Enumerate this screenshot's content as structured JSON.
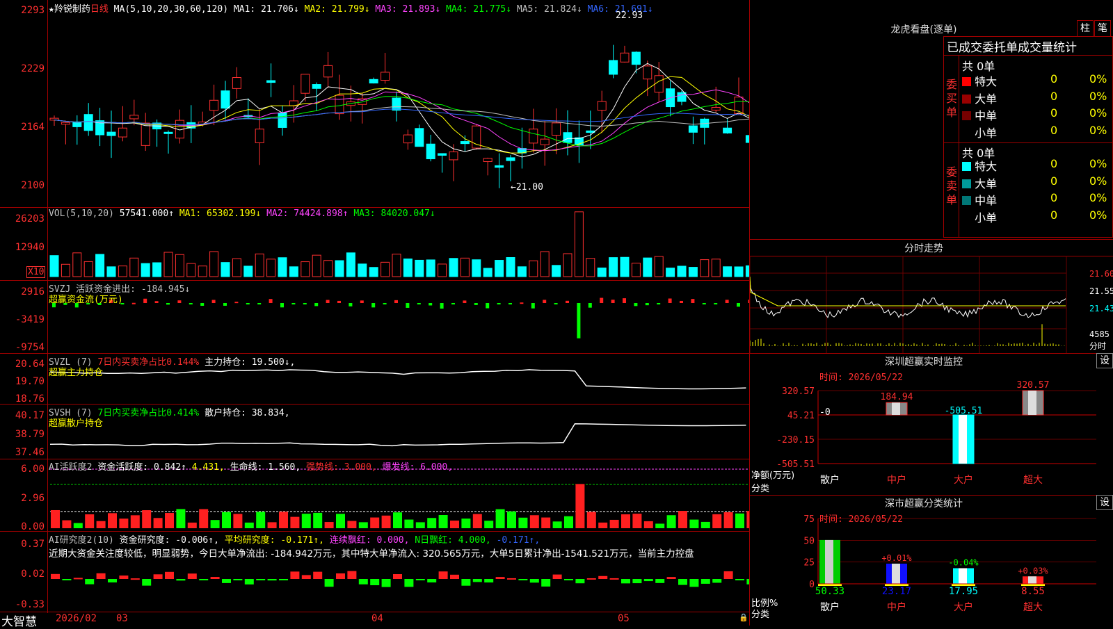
{
  "main_chart": {
    "stock_name": "★羚锐制药",
    "period": "日线",
    "ma_params": "MA(5,10,20,30,60,120)",
    "ma_items": [
      {
        "label": "MA1: 21.706↓",
        "color": "#ffffff"
      },
      {
        "label": "MA2: 21.799↓",
        "color": "#ffff00"
      },
      {
        "label": "MA3: 21.893↓",
        "color": "#ff44ff"
      },
      {
        "label": "MA4: 21.775↓",
        "color": "#00ff00"
      },
      {
        "label": "MA5: 21.824↓",
        "color": "#c0c0c0"
      },
      {
        "label": "MA6: 21.691↓",
        "color": "#3366ff"
      }
    ],
    "y_ticks": [
      "2293",
      "2229",
      "2164",
      "2100"
    ],
    "high_label": "22.93",
    "low_label": "←21.00"
  },
  "vol": {
    "legend": "VOL(5,10,20)",
    "value": "57541.000↑",
    "ma1": "MA1: 65302.199↓",
    "ma2": "MA2: 74424.898↑",
    "ma3": "MA3: 84020.047↓",
    "y_ticks": [
      "26203",
      "12940"
    ],
    "unit": "X10"
  },
  "svzj": {
    "legend": "SVZJ  活跃资金进出: -184.945↓",
    "sub": "超赢资金流(万元)",
    "y_ticks": [
      "2916",
      "-3419",
      "-9754"
    ]
  },
  "svzl": {
    "legend_a": "SVZL (7)",
    "legend_b": "7日内买卖净占比0.144%",
    "legend_c": "主力持仓: 19.500↓,",
    "sub": "超赢主力持仓",
    "y_ticks": [
      "20.64",
      "19.70",
      "18.76"
    ]
  },
  "svsh": {
    "legend_a": "SVSH (7)",
    "legend_b": "7日内买卖净占比0.414%",
    "legend_c": "散户持仓: 38.834,",
    "sub": "超赢散户持仓",
    "y_ticks": [
      "40.17",
      "38.79",
      "37.46"
    ]
  },
  "ai_active": {
    "legend_a": "AI活跃度2",
    "legend_b": "资金活跃度: 0.842↑",
    "legend_c": "4.431,",
    "legend_d": "生命线: 1.560,",
    "legend_e": "强势线: 3.000,",
    "legend_f": "爆发线: 6.000,",
    "y_ticks": [
      "6.00",
      "2.96",
      "0.00"
    ]
  },
  "ai_research": {
    "legend_a": "AI研究度2(10)",
    "legend_b": "资金研究度: -0.006↑,",
    "legend_c": "平均研究度: -0.171↑,",
    "legend_d": "连续飘红: 0.000,",
    "legend_e": "N日飘红: 4.000,",
    "legend_f": "-0.171↑,",
    "comment": "近期大资金关注度较低，明显弱势，今日大单净流出: -184.942万元，其中特大单净流入: 320.565万元，大单5日累计净出-1541.521万元，当前主力控盘",
    "y_ticks": [
      "0.37",
      "0.02",
      "-0.33"
    ]
  },
  "bottom_bar": {
    "brand": "大智慧",
    "dates": [
      "2026/02",
      "03",
      "04",
      "05"
    ]
  },
  "right_panel": {
    "dragon_title": "龙虎看盘(逐单)",
    "tab1": "柱",
    "tab2": "笔",
    "header": "已成交委托单成交量统计",
    "buy_label": "委买单",
    "sell_label": "委卖单",
    "buy_total": "共 0单",
    "sell_total": "共 0单",
    "buy_rows": [
      {
        "name": "特大",
        "count": "0",
        "pct": "0%",
        "color": "#ff0000"
      },
      {
        "name": "大单",
        "count": "0",
        "pct": "0%",
        "color": "#990000"
      },
      {
        "name": "中单",
        "count": "0",
        "pct": "0%",
        "color": "#770000"
      },
      {
        "name": "小单",
        "count": "0",
        "pct": "0%",
        "color": "#000000"
      }
    ],
    "sell_rows": [
      {
        "name": "特大",
        "count": "0",
        "pct": "0%",
        "color": "#00ffff"
      },
      {
        "name": "大单",
        "count": "0",
        "pct": "0%",
        "color": "#009999"
      },
      {
        "name": "中单",
        "count": "0",
        "pct": "0%",
        "color": "#007777"
      },
      {
        "name": "小单",
        "count": "0",
        "pct": "0%",
        "color": "#000000"
      }
    ],
    "fs_title": "分时走势",
    "fs_ticks": [
      "21.60",
      "21.55",
      "21.43"
    ],
    "fs_vol": "4585",
    "fs_unit": "分时",
    "sz_title": "深圳超赢实时监控",
    "sz_set": "设",
    "sz_time": "时间: 2026/05/22",
    "sz_ticks": [
      "320.57",
      "45.21",
      "-230.15",
      "-505.51"
    ],
    "sz_ylabel": "净额(万元)",
    "sz_xlabel": "分类",
    "sz_cats": [
      "散户",
      "中户",
      "大户",
      "超大"
    ],
    "sz_values": [
      -0.0,
      184.94,
      -505.51,
      320.57
    ],
    "sz_labels": [
      "-0",
      "184.94",
      "-505.51",
      "320.57"
    ],
    "cls_title": "深市超赢分类统计",
    "cls_set": "设",
    "cls_time": "时间: 2026/05/22",
    "cls_ticks": [
      "75",
      "50",
      "25",
      "0"
    ],
    "cls_ylabel": "比例%",
    "cls_xlabel": "分类",
    "cls_cats": [
      "散户",
      "中户",
      "大户",
      "超大"
    ],
    "cls_values": [
      50.33,
      23.17,
      17.95,
      8.55
    ],
    "cls_value_labels": [
      "50.33",
      "23.17",
      "17.95",
      "8.55"
    ],
    "cls_change_labels": [
      "",
      "+0.01%",
      "-0.04%",
      "+0.03%"
    ]
  },
  "chart_data": [
    {
      "type": "bar",
      "title": "深圳超赢实时监控",
      "categories": [
        "散户",
        "中户",
        "大户",
        "超大"
      ],
      "values": [
        -0.0,
        184.94,
        -505.51,
        320.57
      ],
      "ylabel": "净额(万元)",
      "ylim": [
        -505.51,
        320.57
      ]
    },
    {
      "type": "bar",
      "title": "深市超赢分类统计",
      "categories": [
        "散户",
        "中户",
        "大户",
        "超大"
      ],
      "values": [
        50.33,
        23.17,
        17.95,
        8.55
      ],
      "ylabel": "比例%",
      "ylim": [
        0,
        75
      ]
    }
  ]
}
